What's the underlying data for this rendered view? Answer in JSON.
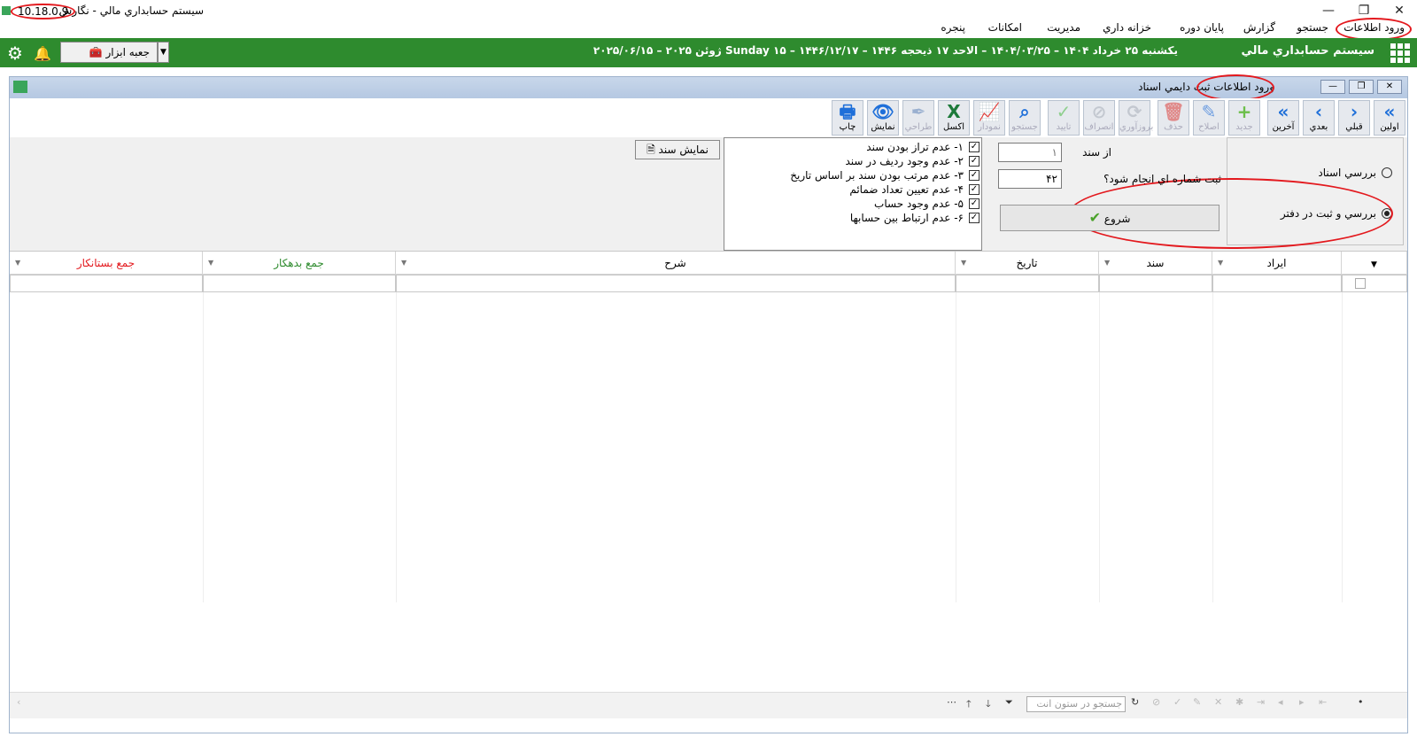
{
  "window": {
    "title": "سيستم حسابداري مالي  - نگارش",
    "version": "10.18.0.9",
    "controls": [
      "—",
      "❐",
      "✕"
    ]
  },
  "menu": [
    "ورود اطلاعات",
    "جستجو",
    "گزارش",
    "پايان دوره",
    "خزانه داري",
    "مديريت",
    "امكانات",
    "پنجره"
  ],
  "banner": {
    "brand": "سيستم حسابداري مالي",
    "date_line": "يكشنبه ۲۵ خرداد ۱۴۰۴ – ۱۴۰۴/۰۳/۲۵ – الاحد ۱۷ ذيحجه ۱۴۴۶ – ۱۴۴۶/۱۲/۱۷ – Sunday ۱۵ ژوئن ۲۰۲۵ – ۲۰۲۵/۰۶/۱۵",
    "toolbox_label": "جعبه ابزار"
  },
  "child_window": {
    "title": "ورود اطلاعات",
    "subtitle": "ثبت دايمي اسناد"
  },
  "toolbar": [
    {
      "label": "اولين",
      "icon": "double-chevron-left-icon",
      "enabled": true
    },
    {
      "label": "قبلي",
      "icon": "chevron-left-icon",
      "enabled": true
    },
    {
      "label": "بعدي",
      "icon": "chevron-right-icon",
      "enabled": true
    },
    {
      "label": "آخرين",
      "icon": "double-chevron-right-icon",
      "enabled": true
    },
    {
      "label": "جديد",
      "icon": "plus-icon",
      "enabled": false
    },
    {
      "label": "اصلاح",
      "icon": "pencil-icon",
      "enabled": false
    },
    {
      "label": "حذف",
      "icon": "trash-icon",
      "enabled": false
    },
    {
      "label": "بروزآوري",
      "icon": "refresh-icon",
      "enabled": false
    },
    {
      "label": "انصراف",
      "icon": "cancel-icon",
      "enabled": false
    },
    {
      "label": "تاييد",
      "icon": "check-icon",
      "enabled": false
    },
    {
      "label": "جستجو",
      "icon": "search-icon",
      "enabled": false
    },
    {
      "label": "نمودار",
      "icon": "chart-icon",
      "enabled": false
    },
    {
      "label": "اكسل",
      "icon": "excel-icon",
      "enabled": true
    },
    {
      "label": "طراحي",
      "icon": "design-pen-icon",
      "enabled": false
    },
    {
      "label": "نمايش",
      "icon": "eye-icon",
      "enabled": true
    },
    {
      "label": "چاپ",
      "icon": "printer-icon",
      "enabled": true
    }
  ],
  "options": {
    "radio_review_docs": "بررسي اسناد",
    "radio_review_and_post": "بررسي و ثبت در دفتر",
    "from_doc_label": "از سند",
    "from_doc_value": "۱",
    "to_doc_label": "ثبت شماره اي انجام شود؟",
    "to_doc_value": "۴۲",
    "start_label": "شروع",
    "show_doc_label": "نمايش سند",
    "checks": [
      "۱- عدم تراز بودن سند",
      "۲- عدم وجود رديف در سند",
      "۳- عدم مرتب بودن سند بر اساس تاريخ",
      "۴- عدم تعيين تعداد ضمائم",
      "۵- عدم وجود حساب",
      "۶- عدم ارتباط بين حسابها"
    ]
  },
  "grid": {
    "columns": [
      "ايراد",
      "سند",
      "تاريخ",
      "شرح",
      "جمع بدهكار",
      "جمع بستانكار"
    ],
    "search_placeholder": "جستجو در ستون انت"
  },
  "colors": {
    "banner_green": "#2e8b2e",
    "debit_header": "#2e8b2e",
    "credit_header": "#e3191e",
    "highlight_oval": "#e3191e"
  }
}
